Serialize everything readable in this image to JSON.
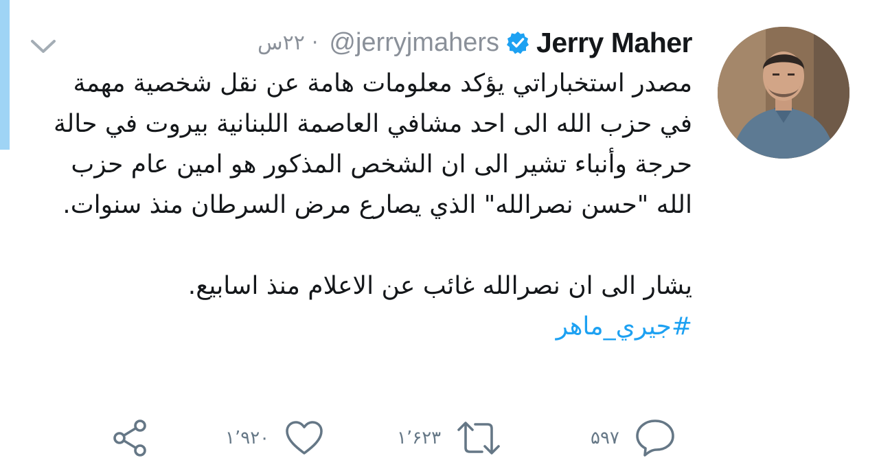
{
  "tweet": {
    "display_name": "Jerry Maher",
    "handle": "@jerryjmahers",
    "time": "۲۲س",
    "separator": "·",
    "paragraph1": "مصدر استخباراتي يؤكد معلومات هامة عن نقل شخصية مهمة في حزب الله الى احد مشافي العاصمة اللبنانية بيروت في حالة حرجة وأنباء تشير الى ان الشخص المذكور هو امين عام حزب الله \"حسن نصرالله\" الذي يصارع مرض السرطان منذ سنوات.",
    "paragraph2": "يشار الى ان نصرالله غائب عن الاعلام منذ اسابيع.",
    "hashtag": "#جيري_ماهر"
  },
  "actions": {
    "reply_count": "۵۹۷",
    "retweet_count": "۱٬۶۲۳",
    "like_count": "۱٬۹۲۰"
  },
  "icons": {
    "verified": "verified-badge-icon",
    "caret": "chevron-down-icon",
    "reply": "reply-icon",
    "retweet": "retweet-icon",
    "like": "heart-icon",
    "share": "share-icon"
  },
  "colors": {
    "accent_bar": "#9fd4f5",
    "verified": "#1da1f2",
    "hashtag": "#1da1f2",
    "muted": "#8a9099",
    "text": "#14171a"
  }
}
